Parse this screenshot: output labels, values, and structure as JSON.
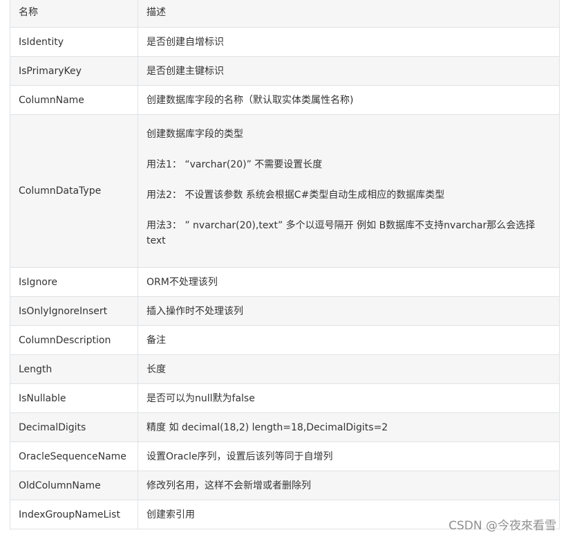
{
  "table": {
    "header": {
      "name": "名称",
      "desc": "描述"
    },
    "rows": [
      {
        "name": "IsIdentity",
        "desc": "是否创建自增标识"
      },
      {
        "name": "IsPrimaryKey",
        "desc": "是否创建主键标识"
      },
      {
        "name": "ColumnName",
        "desc": "创建数据库字段的名称（默认取实体类属性名称)"
      },
      {
        "name": "ColumnDataType",
        "desc_paragraphs": [
          "创建数据库字段的类型",
          "用法1：   “varchar(20)”   不需要设置长度",
          "用法2：      不设置该参数    系统会根据C#类型自动生成相应的数据库类型",
          "用法3：    ” nvarchar(20),text”     多个以逗号隔开 例如 B数据库不支持nvarchar那么会选择text"
        ]
      },
      {
        "name": "IsIgnore",
        "desc": "ORM不处理该列"
      },
      {
        "name": "IsOnlyIgnoreInsert",
        "desc": "插入操作时不处理该列"
      },
      {
        "name": "ColumnDescription",
        "desc": "备注"
      },
      {
        "name": "Length",
        "desc": "长度"
      },
      {
        "name": "IsNullable",
        "desc": "是否可以为null默为false"
      },
      {
        "name": "DecimalDigits",
        "desc": "精度 如 decimal(18,2) length=18,DecimalDigits=2"
      },
      {
        "name": "OracleSequenceName",
        "desc": "设置Oracle序列，设置后该列等同于自增列"
      },
      {
        "name": "OldColumnName",
        "desc": "修改列名用，这样不会新增或者删除列"
      },
      {
        "name": "IndexGroupNameList",
        "desc": "创建索引用"
      }
    ]
  },
  "watermark": "CSDN @今夜來看雪"
}
